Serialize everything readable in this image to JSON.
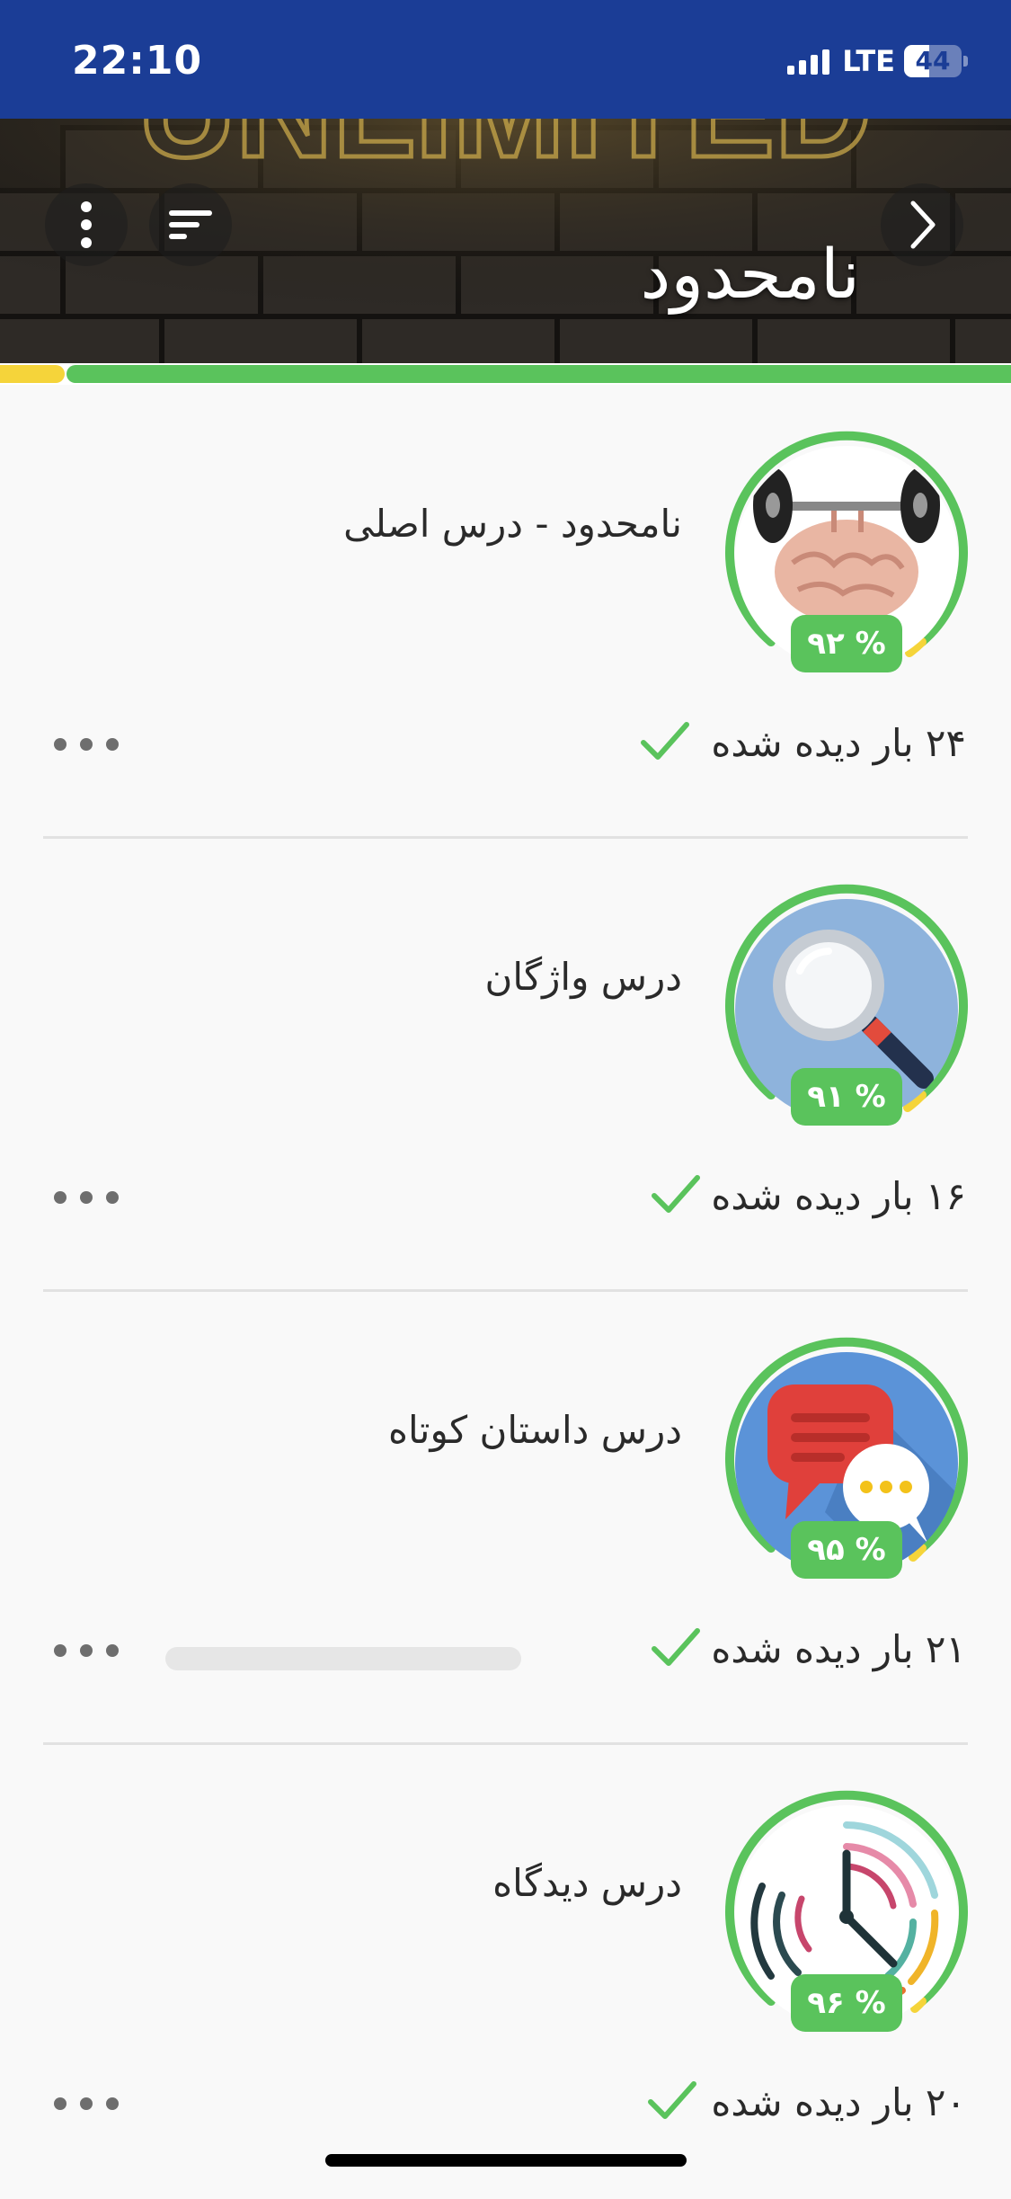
{
  "status_bar": {
    "time": "22:10",
    "network": "LTE",
    "battery_level": "44"
  },
  "header": {
    "title": "نامحدود",
    "background_sign_text": "UNLIMITED",
    "progress": {
      "yellow_fraction": 0.064,
      "green_fraction": 0.936
    }
  },
  "lessons": [
    {
      "title": "نامحدود - درس اصلی",
      "percent": "% ۹۲",
      "views": "۲۴ بار دیده شده",
      "icon": "brain-dumbbell-icon"
    },
    {
      "title": "درس واژگان",
      "percent": "% ۹۱",
      "views": "۱۶ بار دیده شده",
      "icon": "magnifier-icon"
    },
    {
      "title": "درس داستان کوتاه",
      "percent": "% ۹۵",
      "views": "۲۱ بار دیده شده",
      "icon": "chat-bubbles-icon"
    },
    {
      "title": "درس دیدگاه",
      "percent": "% ۹۶",
      "views": "۲۰ بار دیده شده",
      "icon": "clock-icon"
    }
  ],
  "colors": {
    "status_bar": "#1b3d96",
    "accent_green": "#5ac35c",
    "accent_yellow": "#f5d43a"
  }
}
